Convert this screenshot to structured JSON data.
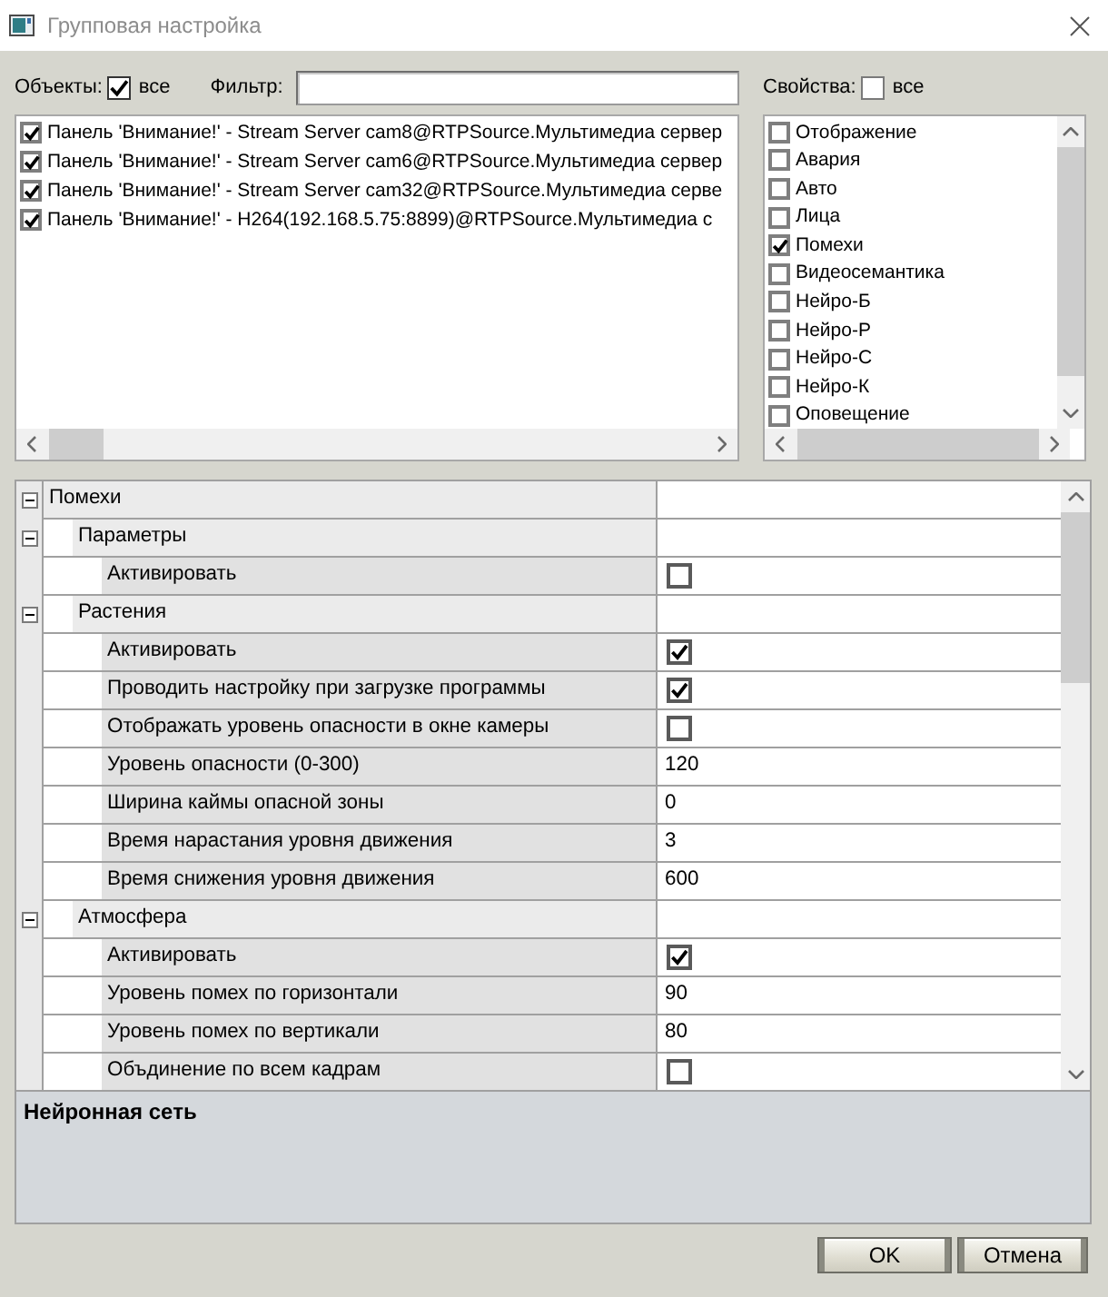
{
  "window": {
    "title": "Групповая настройка"
  },
  "objects": {
    "label": "Объекты:",
    "all": {
      "label": "все",
      "checked": true
    },
    "items": [
      {
        "label": "Панель 'Внимание!' - Stream Server cam8@RTPSource.Мультимедиа сервер",
        "checked": true
      },
      {
        "label": "Панель 'Внимание!' - Stream Server cam6@RTPSource.Мультимедиа сервер",
        "checked": true
      },
      {
        "label": "Панель 'Внимание!' - Stream Server cam32@RTPSource.Мультимедиа серве",
        "checked": true
      },
      {
        "label": "Панель 'Внимание!' - H264(192.168.5.75:8899)@RTPSource.Мультимедиа с",
        "checked": true
      }
    ]
  },
  "filter": {
    "label": "Фильтр:"
  },
  "properties": {
    "label": "Свойства:",
    "all": {
      "label": "все",
      "checked": false
    },
    "items": [
      {
        "label": "Отображение",
        "checked": false
      },
      {
        "label": "Авария",
        "checked": false
      },
      {
        "label": "Авто",
        "checked": false
      },
      {
        "label": "Лица",
        "checked": false
      },
      {
        "label": "Помехи",
        "checked": true
      },
      {
        "label": "Видеосемантика",
        "checked": false
      },
      {
        "label": "Нейро-Б",
        "checked": false
      },
      {
        "label": "Нейро-Р",
        "checked": false
      },
      {
        "label": "Нейро-С",
        "checked": false
      },
      {
        "label": "Нейро-К",
        "checked": false
      },
      {
        "label": "Оповещение",
        "checked": false
      }
    ]
  },
  "property_grid": {
    "rows": [
      {
        "kind": "category",
        "label": "Помехи",
        "expanded": true,
        "children": [
          {
            "kind": "category",
            "label": "Параметры",
            "expanded": true,
            "children": [
              {
                "kind": "checkbox",
                "label": "Активировать",
                "checked": false
              }
            ]
          },
          {
            "kind": "category",
            "label": "Растения",
            "expanded": true,
            "children": [
              {
                "kind": "checkbox",
                "label": "Активировать",
                "checked": true
              },
              {
                "kind": "checkbox",
                "label": "Проводить настройку при загрузке программы",
                "checked": true
              },
              {
                "kind": "checkbox",
                "label": "Отображать уровень опасности в окне камеры",
                "checked": false
              },
              {
                "kind": "value",
                "label": "Уровень опасности (0-300)",
                "value": "120"
              },
              {
                "kind": "value",
                "label": "Ширина каймы опасной зоны",
                "value": "0"
              },
              {
                "kind": "value",
                "label": "Время нарастания уровня движения",
                "value": "3"
              },
              {
                "kind": "value",
                "label": "Время снижения уровня движения",
                "value": "600"
              }
            ]
          },
          {
            "kind": "category",
            "label": "Атмосфера",
            "expanded": true,
            "children": [
              {
                "kind": "checkbox",
                "label": "Активировать",
                "checked": true
              },
              {
                "kind": "value",
                "label": "Уровень помех по горизонтали",
                "value": "90"
              },
              {
                "kind": "value",
                "label": "Уровень помех по вертикали",
                "value": "80"
              },
              {
                "kind": "checkbox",
                "label": "Объдинение по всем кадрам",
                "checked": false
              }
            ]
          }
        ]
      }
    ]
  },
  "description": {
    "title": "Нейронная сеть"
  },
  "buttons": [
    {
      "label": "OK"
    },
    {
      "label": "Отмена"
    }
  ]
}
